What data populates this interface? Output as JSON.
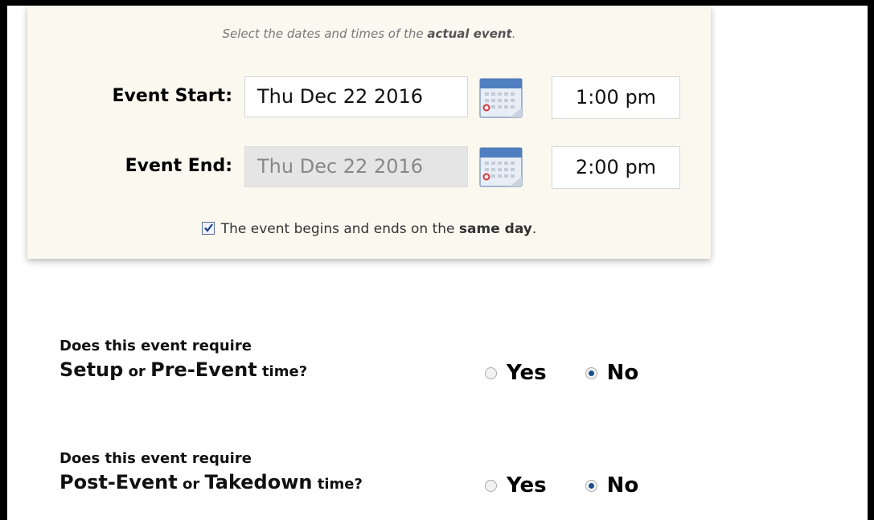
{
  "panel": {
    "instruction_prefix": "Select the dates and times of the",
    "instruction_bold": "actual event",
    "instruction_suffix": ".",
    "start": {
      "label": "Event Start:",
      "date": "Thu Dec 22 2016",
      "time": "1:00 pm"
    },
    "end": {
      "label": "Event End:",
      "date": "Thu Dec 22 2016",
      "time": "2:00 pm"
    },
    "same_day_prefix": "The event begins and ends on the",
    "same_day_bold": "same day",
    "same_day_suffix": ".",
    "same_day_checked": true
  },
  "setup_question": {
    "line1": "Does this event require",
    "big1": "Setup",
    "or": "or",
    "big2": "Pre-Event",
    "tail": "time?",
    "yes": "Yes",
    "no": "No",
    "selected": "No"
  },
  "takedown_question": {
    "line1": "Does this event require",
    "big1": "Post-Event",
    "or": "or",
    "big2": "Takedown",
    "tail": "time?",
    "yes": "Yes",
    "no": "No",
    "selected": "No"
  },
  "colors": {
    "panel_bg": "#fbf8f0",
    "radio_selected": "#1d4e8c",
    "border": "#000000"
  },
  "icons": [
    "calendar-icon",
    "checkmark-icon",
    "radio-icon"
  ]
}
